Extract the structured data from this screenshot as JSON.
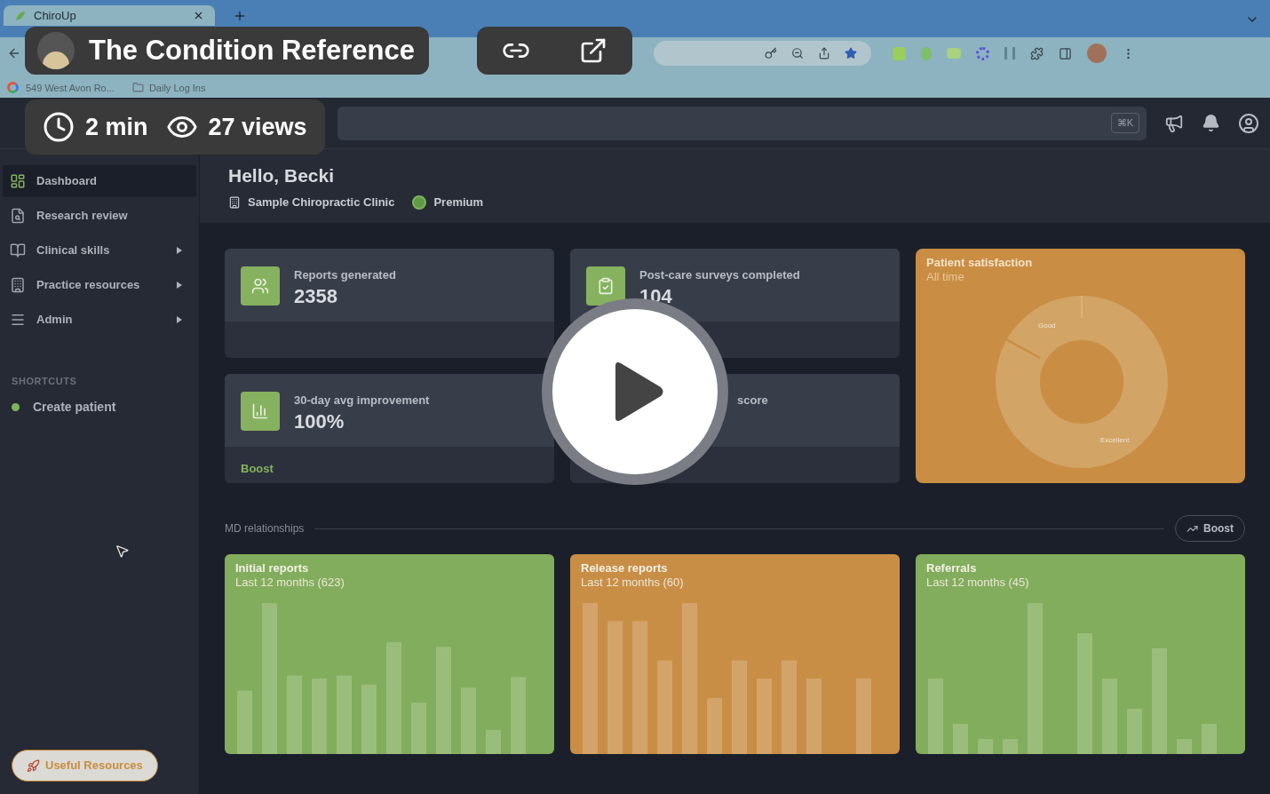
{
  "browser": {
    "tab_title": "ChiroUp",
    "bookmarks": [
      "549 West Avon Ro...",
      "Daily Log Ins"
    ]
  },
  "app_header": {
    "shortcut": "⌘K"
  },
  "sidebar": {
    "items": [
      {
        "label": "Dashboard",
        "selected": true,
        "has_submenu": false
      },
      {
        "label": "Research review",
        "selected": false,
        "has_submenu": false
      },
      {
        "label": "Clinical skills",
        "selected": false,
        "has_submenu": true
      },
      {
        "label": "Practice resources",
        "selected": false,
        "has_submenu": true
      },
      {
        "label": "Admin",
        "selected": false,
        "has_submenu": true
      }
    ],
    "shortcuts_heading": "SHORTCUTS",
    "shortcuts": [
      {
        "label": "Create patient",
        "color": "#7fb35a"
      }
    ],
    "resources_button": "Useful Resources"
  },
  "greeting": {
    "title": "Hello, Becki",
    "clinic": "Sample Chiropractic Clinic",
    "plan": "Premium"
  },
  "stat_cards": [
    {
      "label": "Reports generated",
      "value": "2358"
    },
    {
      "label": "Post-care surveys completed",
      "value": "104"
    },
    {
      "label": "30-day avg improvement",
      "value": "100%",
      "action": "Boost"
    },
    {
      "label": "score"
    }
  ],
  "satisfaction": {
    "title": "Patient satisfaction",
    "subtitle": "All time",
    "segments": [
      "Good",
      "Excellent"
    ]
  },
  "md_relationships": {
    "heading": "MD relationships",
    "button": "Boost",
    "cards": [
      {
        "title": "Initial reports",
        "subtitle": "Last 12 months (623)",
        "color": "#82ad5c"
      },
      {
        "title": "Release reports",
        "subtitle": "Last 12 months (60)",
        "color": "#c88e45"
      },
      {
        "title": "Referrals",
        "subtitle": "Last 12 months (45)",
        "color": "#82ad5c"
      }
    ]
  },
  "overlay": {
    "title": "The Condition Reference",
    "stats": [
      {
        "kind": "duration",
        "text": "2 min"
      },
      {
        "kind": "views",
        "text": "27 views"
      }
    ]
  }
}
